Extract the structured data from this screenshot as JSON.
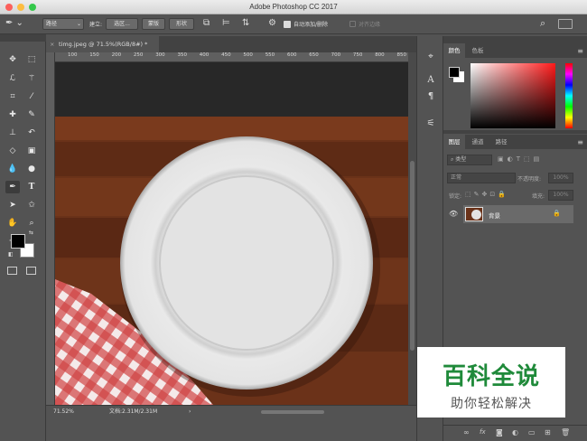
{
  "window": {
    "title": "Adobe Photoshop CC 2017"
  },
  "options_bar": {
    "mode_select": "路径",
    "build_label": "建立:",
    "selection_button": "选区...",
    "mask_button": "蒙版",
    "shape_button": "形状",
    "auto_add_checkbox": "自动添加/删除",
    "align_edges": "对齐边缘"
  },
  "document": {
    "tab_title": "timg.jpeg @ 71.5%(RGB/8#) *",
    "ruler_ticks": [
      "100",
      "150",
      "200",
      "250",
      "300",
      "350",
      "400",
      "450",
      "500",
      "550",
      "600",
      "650",
      "700",
      "750",
      "800",
      "850"
    ]
  },
  "status_bar": {
    "zoom": "71.52%",
    "doc_info": "文档:2.31M/2.31M"
  },
  "panels": {
    "color_tabs": [
      "颜色",
      "色板"
    ],
    "layers_tabs": [
      "图层",
      "通道",
      "路径"
    ],
    "filter_kind": "类型",
    "blend_mode": "正常",
    "opacity_label": "不透明度:",
    "opacity_value": "100%",
    "lock_label": "锁定:",
    "fill_label": "填充:",
    "fill_value": "100%",
    "layer_name": "背景"
  },
  "watermark": {
    "line1": "百科全说",
    "line2": "助你轻松解决"
  },
  "colors": {
    "foreground": "#000000",
    "background": "#ffffff",
    "watermark_green": "#1f8a3a"
  }
}
